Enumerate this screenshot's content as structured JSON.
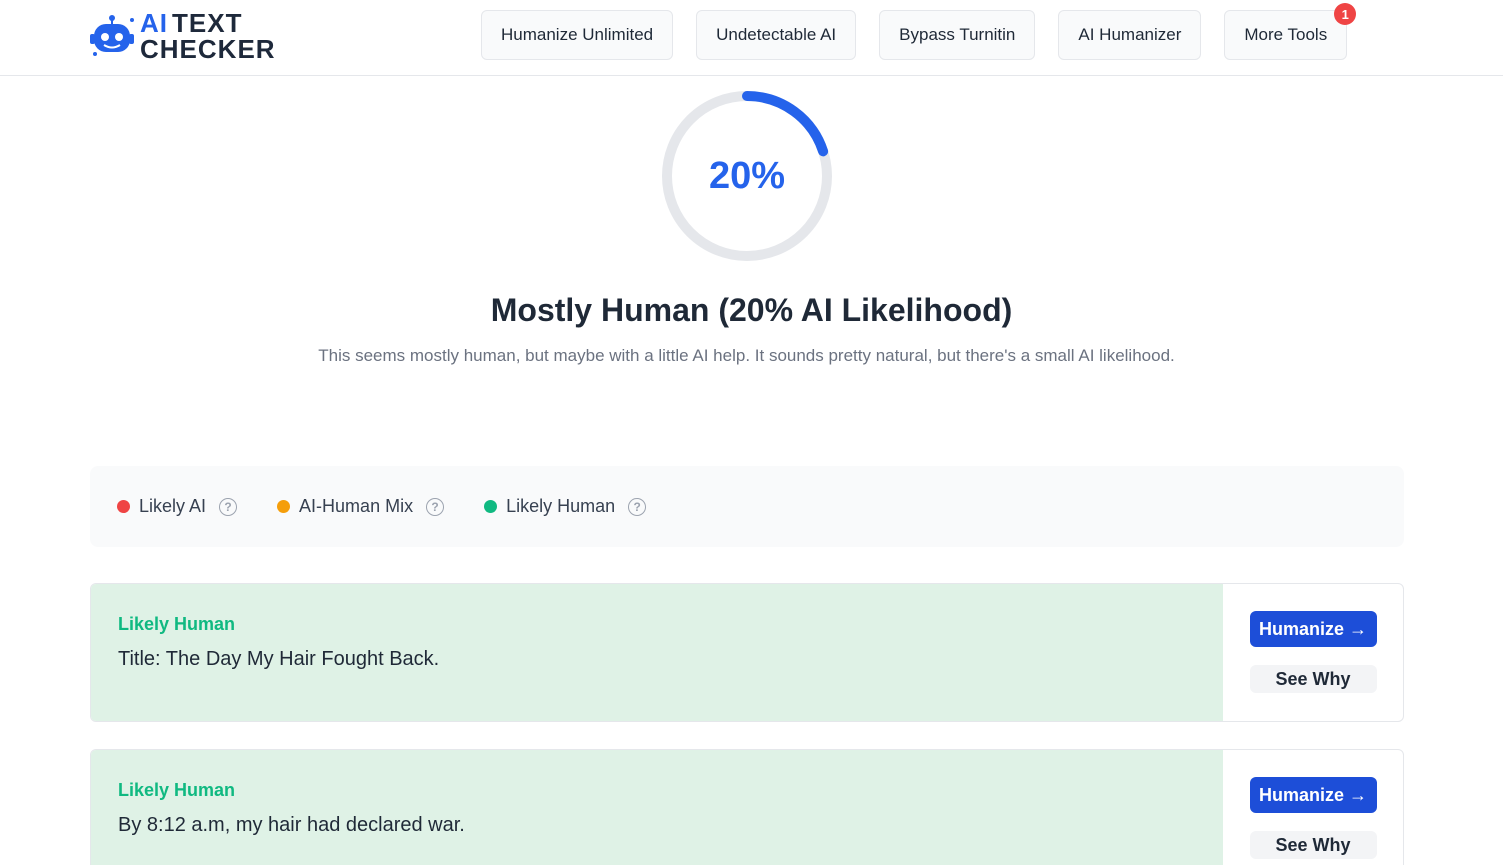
{
  "logo": {
    "line1_ai": "AI",
    "line1_text": "TEXT",
    "line2": "CHECKER"
  },
  "nav": {
    "items": [
      "Humanize Unlimited",
      "Undetectable AI",
      "Bypass Turnitin",
      "AI Humanizer",
      "More Tools"
    ],
    "badge_count": "1"
  },
  "result": {
    "percent_label": "20%",
    "ai_likelihood": 0.2,
    "title": "Mostly Human (20% AI Likelihood)",
    "description": "This seems mostly human, but maybe with a little AI help. It sounds pretty natural, but there's a small AI likelihood."
  },
  "legend": [
    {
      "label": "Likely AI",
      "color": "#ef4444"
    },
    {
      "label": "AI-Human Mix",
      "color": "#f59e0b"
    },
    {
      "label": "Likely Human",
      "color": "#10b981"
    }
  ],
  "cards": [
    {
      "label": "Likely Human",
      "text": "Title: The Day My Hair Fought Back.",
      "humanize": "Humanize →",
      "see_why": "See Why"
    },
    {
      "label": "Likely Human",
      "text": "By 8:12 a.m, my hair had declared war.",
      "humanize": "Humanize →",
      "see_why": "See Why"
    }
  ],
  "colors": {
    "accent": "#2563eb",
    "human_bg": "#dff2e6",
    "human_label": "#10b981"
  },
  "icons": {
    "logo": "robot-icon",
    "help": "question-circle-icon"
  }
}
